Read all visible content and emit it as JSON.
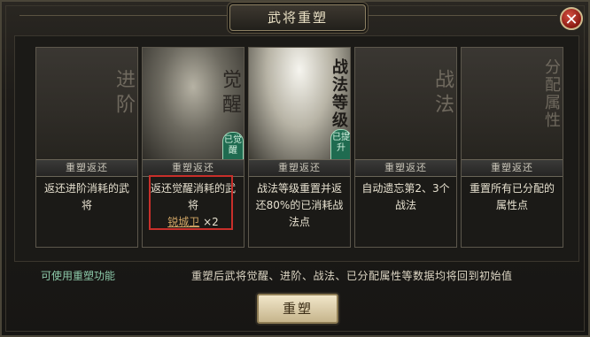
{
  "dialog": {
    "title": "武将重塑",
    "close_icon": "close-icon"
  },
  "cards": [
    {
      "art_title": "进阶",
      "band_label": "重塑返还",
      "description": "返还进阶消耗的武将"
    },
    {
      "art_title": "觉醒",
      "band_label": "重塑返还",
      "seal": "已觉醒",
      "description": "返还觉醒消耗的武将",
      "hero_name": "锐城卫",
      "hero_count": "×2"
    },
    {
      "art_title": "战法等级",
      "band_label": "重塑返还",
      "seal": "已提升",
      "description": "战法等级重置并返还80%的已消耗战法点"
    },
    {
      "art_title": "战法",
      "band_label": "重塑返还",
      "description": "自动遗忘第2、3个战法"
    },
    {
      "art_title": "分配属性",
      "band_label": "重塑返还",
      "description": "重置所有已分配的属性点"
    }
  ],
  "footer": {
    "status_left": "可使用重塑功能",
    "status_right": "重塑后武将觉醒、进阶、战法、已分配属性等数据均将回到初始值",
    "button_label": "重塑"
  },
  "colors": {
    "accent_green": "#8cc9a9",
    "highlight_red": "#c82f2a",
    "button_gold": "#e8dcba"
  }
}
